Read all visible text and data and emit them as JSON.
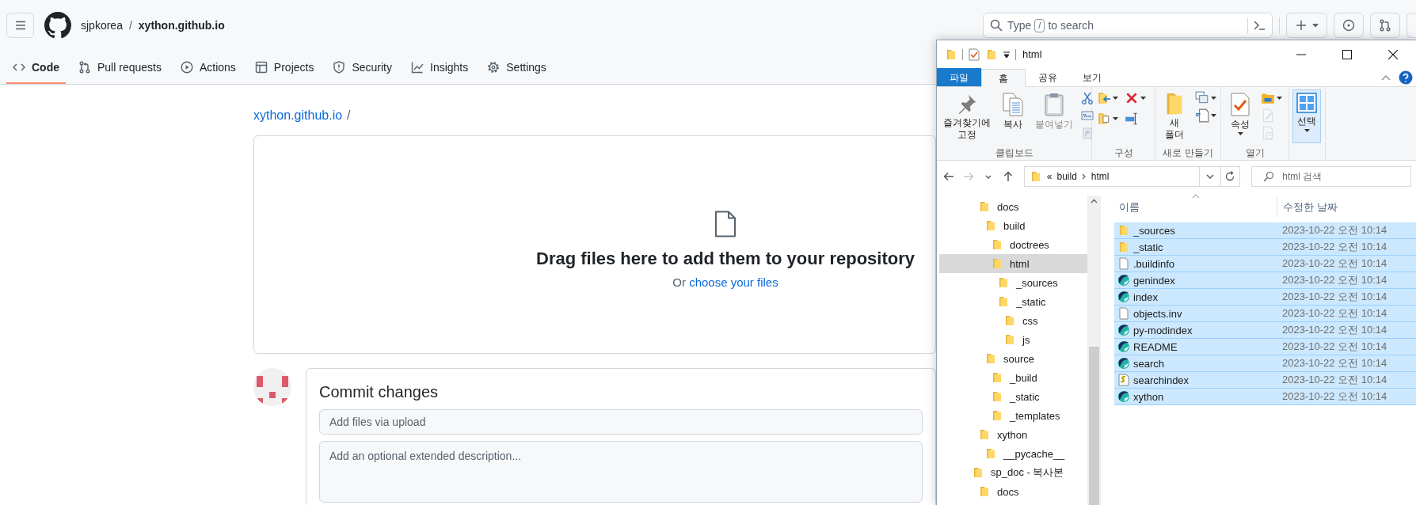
{
  "browser_page": {
    "header": {
      "owner": "sjpkorea",
      "separator": "/",
      "repo": "xython.github.io",
      "search": {
        "before": "Type",
        "key": "/",
        "after": "to search"
      }
    },
    "tabs": [
      {
        "label": "Code",
        "kind": "code",
        "selected": true
      },
      {
        "label": "Pull requests",
        "kind": "pull",
        "selected": false
      },
      {
        "label": "Actions",
        "kind": "play",
        "selected": false
      },
      {
        "label": "Projects",
        "kind": "table",
        "selected": false
      },
      {
        "label": "Security",
        "kind": "shield",
        "selected": false
      },
      {
        "label": "Insights",
        "kind": "graph",
        "selected": false
      },
      {
        "label": "Settings",
        "kind": "gear",
        "selected": false
      }
    ],
    "path": {
      "repo": "xython.github.io",
      "separator": "/"
    },
    "dropzone": {
      "title": "Drag files here to add them to your repository",
      "prefix": "Or",
      "link": "choose your files"
    },
    "commit": {
      "title": "Commit changes",
      "summary": {
        "placeholder": "Add files via upload"
      },
      "description": {
        "placeholder": "Add an optional extended description..."
      }
    }
  },
  "explorer": {
    "title": "html",
    "ribbon_tabs": [
      {
        "label": "파일",
        "kind": "menu",
        "selected": false
      },
      {
        "label": "홈",
        "kind": "tab",
        "selected": true
      },
      {
        "label": "공유",
        "kind": "tab",
        "selected": false
      },
      {
        "label": "보기",
        "kind": "tab",
        "selected": false
      }
    ],
    "ribbon_groups": [
      {
        "label": "클립보드",
        "buttons": [
          {
            "label": "즐겨찾기에 고정",
            "kind": "pin",
            "disabled": false,
            "active": false,
            "caret": false
          },
          {
            "label": "복사",
            "kind": "copy",
            "disabled": false,
            "active": false,
            "caret": false
          },
          {
            "label": "붙여넣기",
            "kind": "paste",
            "disabled": true,
            "active": false,
            "caret": false
          }
        ],
        "small": [
          {
            "kind": "cut",
            "disabled": false,
            "caret": false
          },
          {
            "kind": "copy-path",
            "disabled": false,
            "caret": false
          },
          {
            "kind": "paste-shortcut",
            "disabled": true,
            "caret": false
          }
        ]
      },
      {
        "label": "구성",
        "small": [
          {
            "kind": "move-to",
            "disabled": false,
            "caret": true
          },
          {
            "kind": "delete",
            "disabled": false,
            "caret": true
          },
          {
            "kind": "copy-to",
            "disabled": false,
            "caret": true
          },
          {
            "kind": "rename",
            "disabled": false,
            "caret": false
          }
        ]
      },
      {
        "label": "새로 만들기",
        "buttons": [
          {
            "label": "새 폴더",
            "kind": "new-folder",
            "disabled": false,
            "active": false,
            "caret": false
          }
        ],
        "small": [
          {
            "kind": "new-item",
            "disabled": false,
            "caret": true
          },
          {
            "kind": "easy-access",
            "disabled": false,
            "caret": true
          }
        ]
      },
      {
        "label": "열기",
        "buttons": [
          {
            "label": "속성",
            "kind": "properties",
            "disabled": false,
            "active": false,
            "caret": true
          }
        ],
        "small": [
          {
            "kind": "open",
            "disabled": false,
            "caret": true
          },
          {
            "kind": "edit",
            "disabled": true,
            "caret": false
          },
          {
            "kind": "history",
            "disabled": true,
            "caret": false
          }
        ]
      },
      {
        "buttons": [
          {
            "label": "선택",
            "kind": "select",
            "disabled": false,
            "active": true,
            "caret": true
          }
        ]
      }
    ],
    "nav": [
      {
        "kind": "back",
        "disabled": false
      },
      {
        "kind": "forward",
        "disabled": true
      },
      {
        "kind": "recent",
        "disabled": false
      },
      {
        "kind": "up",
        "disabled": false
      }
    ],
    "address": {
      "overflow": "«",
      "segments": [
        "build",
        "html"
      ]
    },
    "search": {
      "placeholder": "html 검색"
    },
    "tree": [
      {
        "children": [
          {
            "label": "docs",
            "selected": false,
            "children": [
              {
                "label": "build",
                "selected": false,
                "children": [
                  {
                    "label": "doctrees",
                    "selected": false
                  },
                  {
                    "label": "html",
                    "selected": true,
                    "children": [
                      {
                        "label": "_sources",
                        "selected": false
                      },
                      {
                        "label": "_static",
                        "selected": false,
                        "children": [
                          {
                            "label": "css",
                            "selected": false
                          },
                          {
                            "label": "js",
                            "selected": false
                          }
                        ]
                      }
                    ]
                  }
                ]
              },
              {
                "label": "source",
                "selected": false,
                "children": [
                  {
                    "label": "_build",
                    "selected": false
                  },
                  {
                    "label": "_static",
                    "selected": false
                  },
                  {
                    "label": "_templates",
                    "selected": false
                  }
                ]
              }
            ]
          },
          {
            "label": "xython",
            "selected": false,
            "children": [
              {
                "label": "__pycache__",
                "selected": false
              }
            ]
          }
        ]
      },
      {
        "label": "sp_doc - 복사본",
        "selected": false,
        "children": [
          {
            "label": "docs",
            "selected": false
          }
        ]
      }
    ],
    "columns": [
      {
        "label": "이름",
        "sorted": true
      },
      {
        "label": "수정한 날짜",
        "sorted": false
      }
    ],
    "files": [
      {
        "name": "_sources",
        "date": "2023-10-22 오전 10:14",
        "kind": "folder",
        "selected": true
      },
      {
        "name": "_static",
        "date": "2023-10-22 오전 10:14",
        "kind": "folder",
        "selected": true
      },
      {
        "name": ".buildinfo",
        "date": "2023-10-22 오전 10:14",
        "kind": "file",
        "selected": true
      },
      {
        "name": "genindex",
        "date": "2023-10-22 오전 10:14",
        "kind": "page",
        "selected": true
      },
      {
        "name": "index",
        "date": "2023-10-22 오전 10:14",
        "kind": "page",
        "selected": true
      },
      {
        "name": "objects.inv",
        "date": "2023-10-22 오전 10:14",
        "kind": "file",
        "selected": true
      },
      {
        "name": "py-modindex",
        "date": "2023-10-22 오전 10:14",
        "kind": "page",
        "selected": true
      },
      {
        "name": "README",
        "date": "2023-10-22 오전 10:14",
        "kind": "page",
        "selected": true
      },
      {
        "name": "search",
        "date": "2023-10-22 오전 10:14",
        "kind": "page",
        "selected": true
      },
      {
        "name": "searchindex",
        "date": "2023-10-22 오전 10:14",
        "kind": "script",
        "selected": true
      },
      {
        "name": "xython",
        "date": "2023-10-22 오전 10:14",
        "kind": "page",
        "selected": true
      }
    ]
  }
}
